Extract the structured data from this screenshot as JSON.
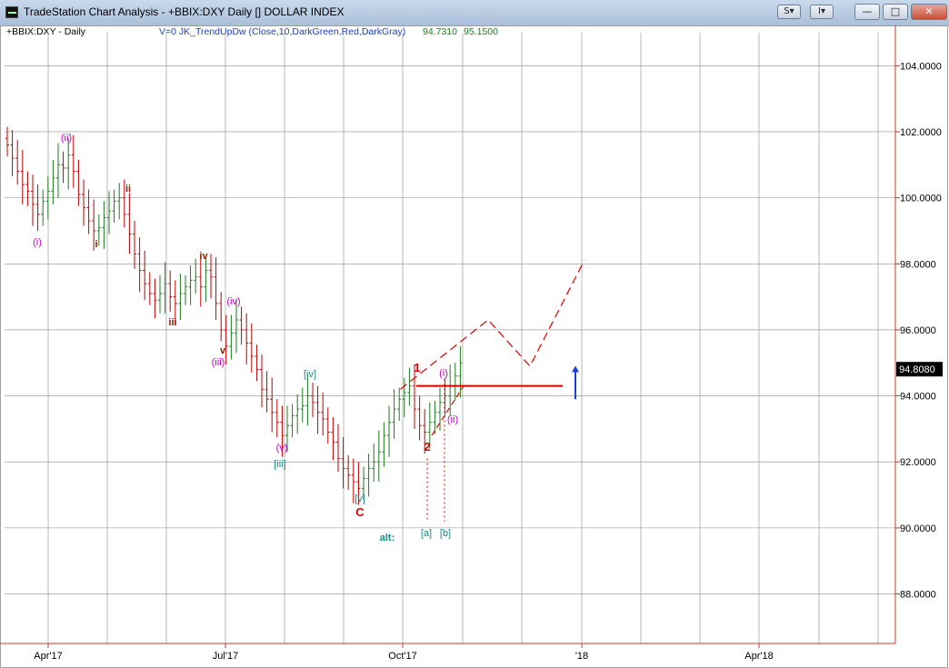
{
  "window": {
    "title": "TradeStation Chart Analysis - +BBIX:DXY Daily [] DOLLAR INDEX",
    "tool_btn_1": "S▾",
    "tool_btn_2": "I▾",
    "minimize": "—",
    "maximize": "□",
    "close": "✕"
  },
  "chart_header": {
    "symbol": "+BBIX:DXY - Daily",
    "indicator": "V=0  JK_TrendUpDw  (Close,10,DarkGreen,Red,DarkGray)",
    "value1": "94.7310",
    "value2": "95.1500"
  },
  "colors": {
    "grid": "#8a8a8a",
    "axis_border": "#c0392b",
    "up_bar": "#1e7a1e",
    "down_bar": "#c00000",
    "neutral_bar": "#777777",
    "magenta": "#cc00cc",
    "teal": "#1a8a8a",
    "red_label": "#dd0000",
    "dark_red": "#8b1a00",
    "projection": "#dd0000",
    "arrow": "#1a3fd6",
    "indicator_text": "#2040c0",
    "value_text": "#1e7a1e"
  },
  "chart_data": {
    "type": "ohlc",
    "ylim": [
      86.5,
      105
    ],
    "y_ticks": [
      "104.0000",
      "102.0000",
      "100.0000",
      "98.0000",
      "96.0000",
      "94.0000",
      "92.0000",
      "90.0000",
      "88.0000"
    ],
    "y_tick_values": [
      104,
      102,
      100,
      98,
      96,
      94,
      92,
      90,
      88
    ],
    "x_tick_labels": [
      "Apr'17",
      "Jul'17",
      "Oct'17",
      "'18",
      "Apr'18"
    ],
    "last_price_label": "94.8080",
    "last_price": 94.808,
    "approx_closes": [
      101.6,
      101.2,
      100.8,
      100.4,
      100.2,
      99.8,
      99.5,
      99.9,
      100.2,
      100.6,
      101.0,
      100.9,
      101.3,
      100.8,
      100.1,
      99.7,
      99.3,
      99.0,
      99.1,
      99.4,
      99.6,
      99.9,
      100.0,
      99.5,
      98.9,
      98.3,
      97.8,
      97.4,
      97.1,
      96.9,
      97.1,
      97.4,
      97.0,
      96.8,
      97.1,
      97.3,
      97.5,
      97.6,
      97.3,
      97.8,
      97.6,
      96.8,
      96.0,
      95.5,
      95.9,
      96.3,
      96.0,
      95.6,
      95.2,
      94.8,
      94.2,
      93.9,
      93.5,
      93.2,
      92.8,
      93.1,
      93.4,
      93.6,
      93.7,
      94.0,
      93.8,
      93.5,
      93.3,
      92.9,
      92.6,
      92.1,
      91.8,
      91.6,
      91.4,
      91.2,
      91.5,
      91.8,
      92.0,
      92.3,
      92.8,
      93.2,
      93.6,
      93.9,
      94.1,
      94.3,
      93.6,
      93.1,
      92.9,
      93.2,
      93.5,
      93.8,
      94.0,
      94.3,
      94.6,
      95.0
    ],
    "projection_path": [
      {
        "date_index": 94,
        "price": 94.2
      },
      {
        "date_index": 115,
        "price": 96.3
      },
      {
        "date_index": 125,
        "price": 94.9
      },
      {
        "date_index": 138,
        "price": 98.1
      }
    ],
    "horizontal_level": 94.3,
    "wave_labels": [
      {
        "text": "(ii)",
        "color": "magenta"
      },
      {
        "text": "(i)",
        "color": "magenta"
      },
      {
        "text": "ii",
        "color": "dark_red"
      },
      {
        "text": "i",
        "color": "dark_red"
      },
      {
        "text": "iv",
        "color": "dark_red"
      },
      {
        "text": "iii",
        "color": "dark_red"
      },
      {
        "text": "(iv)",
        "color": "magenta"
      },
      {
        "text": "v",
        "color": "dark_red"
      },
      {
        "text": "(iii)",
        "color": "magenta"
      },
      {
        "text": "[iv]",
        "color": "teal"
      },
      {
        "text": "(v)",
        "color": "magenta"
      },
      {
        "text": "[iii]",
        "color": "teal"
      },
      {
        "text": "[v]",
        "color": "teal"
      },
      {
        "text": "C",
        "color": "red_label"
      },
      {
        "text": "alt:",
        "color": "teal"
      },
      {
        "text": "[a]",
        "color": "teal"
      },
      {
        "text": "[b]",
        "color": "teal"
      },
      {
        "text": "1",
        "color": "red_label"
      },
      {
        "text": "2",
        "color": "red_label"
      },
      {
        "text": "(i)",
        "color": "magenta"
      },
      {
        "text": "(ii)",
        "color": "magenta"
      }
    ]
  }
}
